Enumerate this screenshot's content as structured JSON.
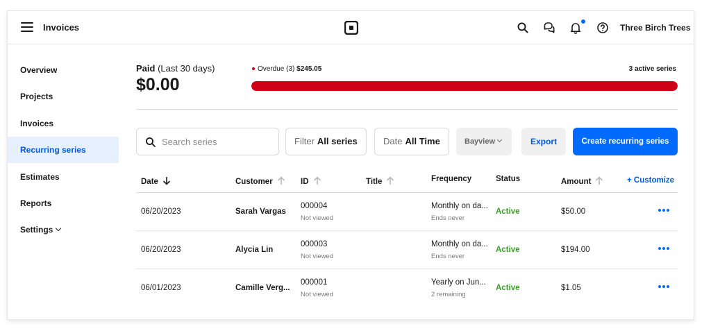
{
  "header": {
    "title": "Invoices",
    "logo_icon": "square-logo-icon",
    "icons": [
      "search-icon",
      "messages-icon",
      "bell-icon",
      "help-icon"
    ],
    "notification_dot_color": "#006aff",
    "account": "Three Birch Trees"
  },
  "sidebar": {
    "items": [
      {
        "label": "Overview"
      },
      {
        "label": "Projects"
      },
      {
        "label": "Invoices"
      },
      {
        "label": "Recurring series",
        "active": true
      },
      {
        "label": "Estimates"
      },
      {
        "label": "Reports"
      },
      {
        "label": "Settings",
        "has_chevron": true
      }
    ]
  },
  "summary": {
    "paid_label": "Paid",
    "paid_period": "(Last 30 days)",
    "paid_amount": "$0.00",
    "overdue_label": "Overdue (3)",
    "overdue_amount": "$245.05",
    "overdue_fraction": 1.0,
    "overdue_color": "#cf0016",
    "active_series": "3 active series"
  },
  "controls": {
    "search_placeholder": "Search series",
    "filter_key": "Filter",
    "filter_value": "All series",
    "date_key": "Date",
    "date_value": "All Time",
    "location": "Bayview",
    "export": "Export",
    "create": "Create recurring series",
    "accent": "#006aff"
  },
  "table": {
    "headers": {
      "date": "Date",
      "customer": "Customer",
      "id": "ID",
      "title": "Title",
      "frequency": "Frequency",
      "status": "Status",
      "amount": "Amount",
      "customize": "+ Customize"
    },
    "status_color": "#3a9e27",
    "rows": [
      {
        "date": "06/20/2023",
        "customer": "Sarah Vargas",
        "id": "000004",
        "id_note": "Not viewed",
        "title": "",
        "frequency": "Monthly on da...",
        "frequency_note": "Ends never",
        "status": "Active",
        "amount": "$50.00"
      },
      {
        "date": "06/20/2023",
        "customer": "Alycia Lin",
        "id": "000003",
        "id_note": "Not viewed",
        "title": "",
        "frequency": "Monthly on da...",
        "frequency_note": "Ends never",
        "status": "Active",
        "amount": "$194.00"
      },
      {
        "date": "06/01/2023",
        "customer": "Camille Verg...",
        "id": "000001",
        "id_note": "Not viewed",
        "title": "",
        "frequency": "Yearly on Jun...",
        "frequency_note": "2 remaining",
        "status": "Active",
        "amount": "$1.05"
      }
    ]
  }
}
